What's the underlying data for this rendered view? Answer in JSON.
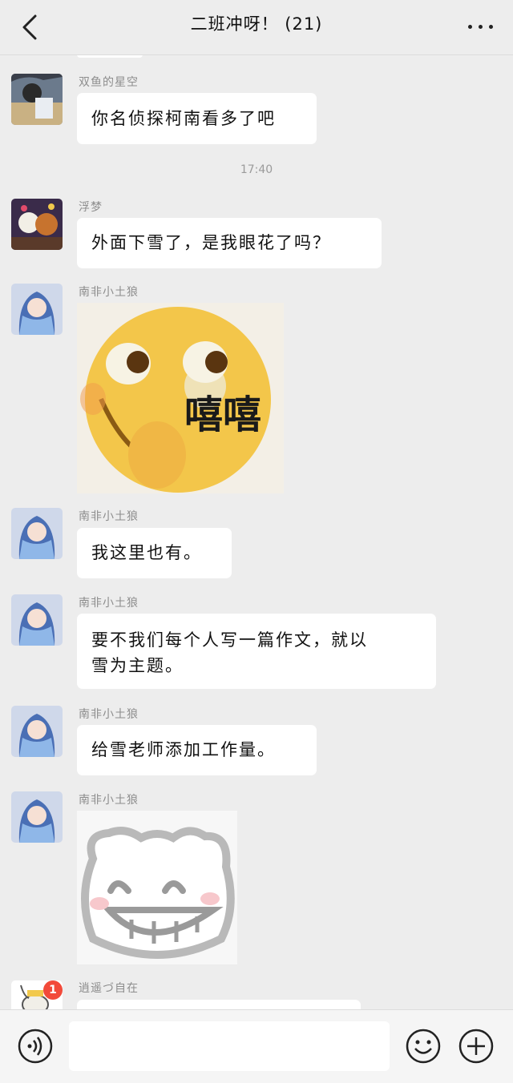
{
  "header": {
    "title": "二班冲呀！ (21)"
  },
  "messages": [
    {
      "sender": "双鱼的星空",
      "text": "你名侦探柯南看多了吧"
    },
    {
      "sender": "浮梦",
      "text": "外面下雪了，是我眼花了吗？"
    },
    {
      "sender": "南非小土狼",
      "sticker_caption": "嘻嘻"
    },
    {
      "sender": "南非小土狼",
      "text": "我这里也有。"
    },
    {
      "sender": "南非小土狼",
      "text_line1": "要不我们每个人写一篇作文，就以",
      "text_line2": "雪为主题。"
    },
    {
      "sender": "南非小土狼",
      "text": "给雪老师添加工作量。"
    },
    {
      "sender": "南非小土狼"
    },
    {
      "sender": "逍遥づ自在",
      "badge": "1"
    }
  ],
  "timestamp": "17:40",
  "colors": {
    "background": "#ededed",
    "bubble": "#ffffff",
    "badge": "#f24a3a"
  },
  "icons": {
    "back": "chevron-left-icon",
    "more": "more-dots-icon",
    "voice": "voice-icon",
    "emoji": "emoji-icon",
    "add": "plus-icon"
  }
}
